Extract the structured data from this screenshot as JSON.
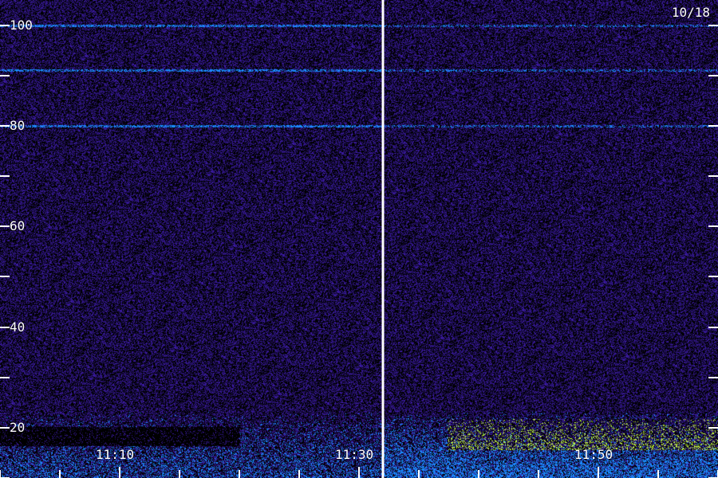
{
  "chart_data": {
    "type": "heatmap",
    "date_label": "10/18",
    "y_tick_labels": [
      "100",
      "80",
      "60",
      "40",
      "20"
    ],
    "y_ticks": [
      100,
      80,
      60,
      40,
      20
    ],
    "y_minor_ticks": [
      90,
      70,
      50,
      30,
      10
    ],
    "ylim": [
      10,
      105
    ],
    "x_tick_labels": [
      "11:10",
      "11:30",
      "11:50"
    ],
    "x_tick_times": [
      "11:10",
      "11:30",
      "11:50"
    ],
    "xlim": [
      "11:00",
      "12:00"
    ],
    "x_minor_tick_step_minutes": 5,
    "divider_time": "11:32",
    "interference_lines": [
      100,
      91,
      80
    ],
    "colors": {
      "background": "#1e0f55",
      "noise": "#3a1aa0",
      "high": "#1a8cff",
      "hot": "#c8ff3c",
      "tick": "#ffffff"
    }
  }
}
